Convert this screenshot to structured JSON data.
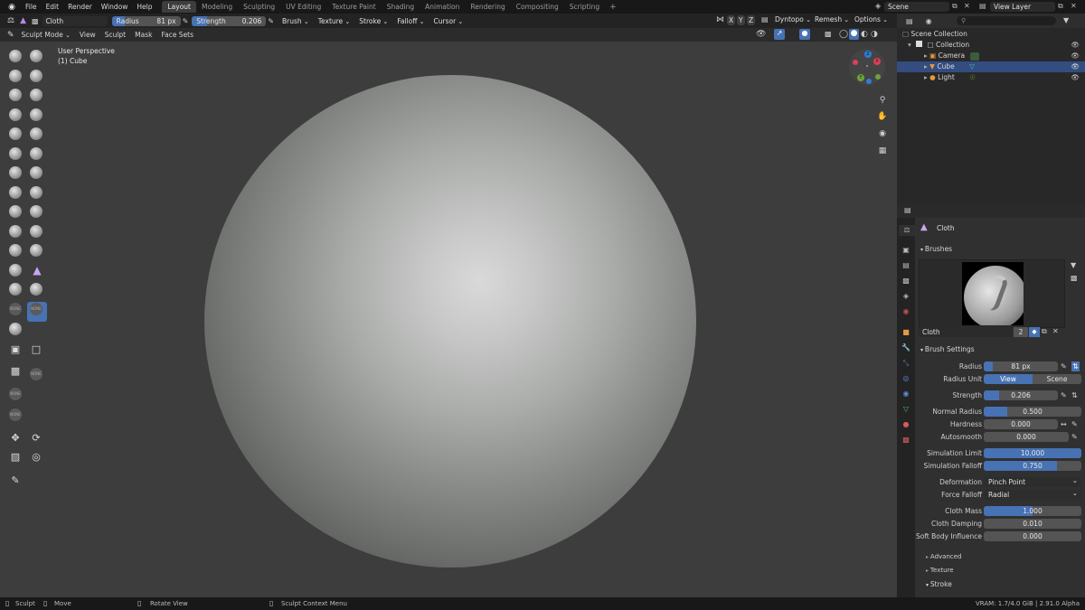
{
  "menubar": {
    "items": [
      "File",
      "Edit",
      "Render",
      "Window",
      "Help"
    ],
    "workspaces": [
      "Layout",
      "Modeling",
      "Sculpting",
      "UV Editing",
      "Texture Paint",
      "Shading",
      "Animation",
      "Rendering",
      "Compositing",
      "Scripting"
    ],
    "active_workspace": "Layout",
    "scene": "Scene",
    "view_layer": "View Layer"
  },
  "toolheader": {
    "brush_name": "Cloth",
    "radius_label": "Radius",
    "radius_value": "81 px",
    "strength_label": "Strength",
    "strength_value": "0.206",
    "strength_fraction": 0.206,
    "menus": [
      "Brush",
      "Texture",
      "Stroke",
      "Falloff",
      "Cursor"
    ],
    "axes": [
      "X",
      "Y",
      "Z"
    ],
    "dyntopo": "Dyntopo",
    "remesh": "Remesh",
    "options": "Options"
  },
  "modeheader": {
    "mode": "Sculpt Mode",
    "menus": [
      "View",
      "Sculpt",
      "Mask",
      "Face Sets"
    ]
  },
  "viewport": {
    "perspective": "User Perspective",
    "object": "(1) Cube",
    "tag_text": "NONE"
  },
  "gizmo": {
    "x": "X",
    "y": "Y",
    "z": "Z"
  },
  "outliner": {
    "root": "Scene Collection",
    "collection": "Collection",
    "objects": [
      "Camera",
      "Cube",
      "Light"
    ],
    "selected": "Cube"
  },
  "properties": {
    "brush_title": "Cloth",
    "brushes_section": "Brushes",
    "brush_name": "Cloth",
    "brush_users": "2",
    "brush_settings_section": "Brush Settings",
    "radius_label": "Radius",
    "radius_value": "81 px",
    "radius_unit_label": "Radius Unit",
    "radius_unit_view": "View",
    "radius_unit_scene": "Scene",
    "strength_label": "Strength",
    "strength_value": "0.206",
    "normal_radius_label": "Normal Radius",
    "normal_radius_value": "0.500",
    "hardness_label": "Hardness",
    "hardness_value": "0.000",
    "autosmooth_label": "Autosmooth",
    "autosmooth_value": "0.000",
    "sim_limit_label": "Simulation Limit",
    "sim_limit_value": "10.000",
    "sim_falloff_label": "Simulation Falloff",
    "sim_falloff_value": "0.750",
    "deformation_label": "Deformation",
    "deformation_value": "Pinch Point",
    "force_falloff_label": "Force Falloff",
    "force_falloff_value": "Radial",
    "cloth_mass_label": "Cloth Mass",
    "cloth_mass_value": "1.000",
    "cloth_damping_label": "Cloth Damping",
    "cloth_damping_value": "0.010",
    "soft_body_label": "Soft Body Influence",
    "soft_body_value": "0.000",
    "sub_advanced": "Advanced",
    "sub_texture": "Texture",
    "sub_stroke": "Stroke"
  },
  "statusbar": {
    "sculpt": "Sculpt",
    "move": "Move",
    "rotate": "Rotate View",
    "context": "Sculpt Context Menu",
    "vram": "VRAM: 1.7/4.0 GiB | 2.91.0 Alpha"
  },
  "colors": {
    "accent": "#4772b3",
    "selected_row": "#334d80",
    "viewport_bg": "#3d3d3d"
  }
}
